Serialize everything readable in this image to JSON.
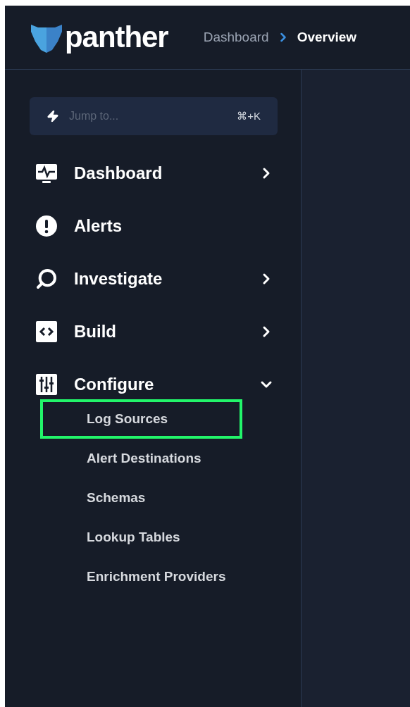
{
  "header": {
    "logo_text": "panther",
    "breadcrumb": [
      {
        "label": "Dashboard",
        "current": false
      },
      {
        "label": "Overview",
        "current": true
      }
    ]
  },
  "jump": {
    "placeholder": "Jump to...",
    "shortcut": "⌘+K"
  },
  "nav": [
    {
      "kind": "group",
      "label": "Dashboard",
      "expanded": false
    },
    {
      "kind": "link",
      "label": "Alerts"
    },
    {
      "kind": "group",
      "label": "Investigate",
      "expanded": false
    },
    {
      "kind": "group",
      "label": "Build",
      "expanded": false
    },
    {
      "kind": "group",
      "label": "Configure",
      "expanded": true,
      "children": [
        {
          "label": "Log Sources",
          "highlighted": true
        },
        {
          "label": "Alert Destinations",
          "highlighted": false
        },
        {
          "label": "Schemas",
          "highlighted": false
        },
        {
          "label": "Lookup Tables",
          "highlighted": false
        },
        {
          "label": "Enrichment Providers",
          "highlighted": false
        }
      ]
    }
  ]
}
